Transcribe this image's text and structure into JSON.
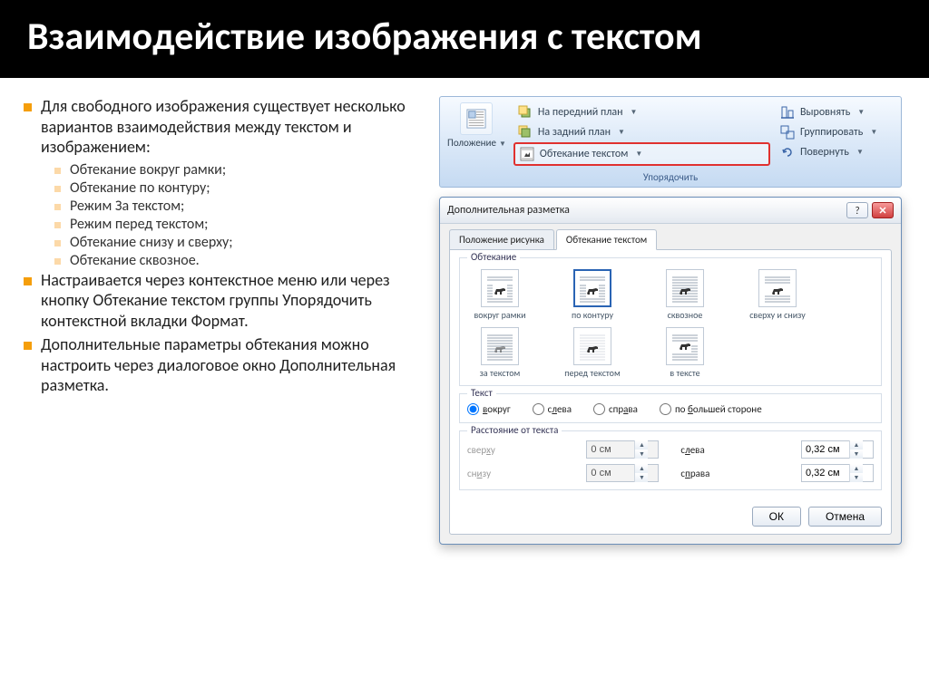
{
  "slide": {
    "title": "Взаимодействие изображения с текстом",
    "bullets": [
      {
        "level": 1,
        "text": "Для свободного изображения существует несколько вариантов взаимодействия между текстом и изображением:"
      },
      {
        "level": 2,
        "text": "Обтекание вокруг рамки;"
      },
      {
        "level": 2,
        "text": "Обтекание по контуру;"
      },
      {
        "level": 2,
        "text": "Режим За текстом;"
      },
      {
        "level": 2,
        "text": "Режим перед текстом;"
      },
      {
        "level": 2,
        "text": "Обтекание снизу и сверху;"
      },
      {
        "level": 2,
        "text": "Обтекание сквозное."
      },
      {
        "level": 1,
        "text": "Настраивается через контекстное меню или через кнопку Обтекание текстом группы Упорядочить контекстной вкладки Формат."
      },
      {
        "level": 1,
        "text": "Дополнительные параметры обтекания можно настроить через диалоговое окно Дополнительная разметка."
      }
    ]
  },
  "ribbon": {
    "position_label": "Положение",
    "bring_front": "На передний план",
    "send_back": "На задний план",
    "text_wrap": "Обтекание текстом",
    "align": "Выровнять",
    "group": "Группировать",
    "rotate": "Повернуть",
    "group_label": "Упорядочить"
  },
  "dialog": {
    "title": "Дополнительная разметка",
    "tab1": "Положение рисунка",
    "tab2": "Обтекание текстом",
    "group_wrap": "Обтекание",
    "wrap_options": [
      "вокруг рамки",
      "по контуру",
      "сквозное",
      "сверху и снизу",
      "за текстом",
      "перед текстом",
      "в тексте"
    ],
    "selected_wrap_index": 1,
    "group_text": "Текст",
    "radio_around": "вокруг",
    "radio_left": "слева",
    "radio_right": "справа",
    "radio_largest": "по большей стороне",
    "group_dist": "Расстояние от текста",
    "dist_top": "сверху",
    "dist_bottom": "снизу",
    "dist_left": "слева",
    "dist_right": "справа",
    "val_top": "0 см",
    "val_bottom": "0 см",
    "val_left": "0,32 см",
    "val_right": "0,32 см",
    "btn_ok": "ОК",
    "btn_cancel": "Отмена"
  }
}
